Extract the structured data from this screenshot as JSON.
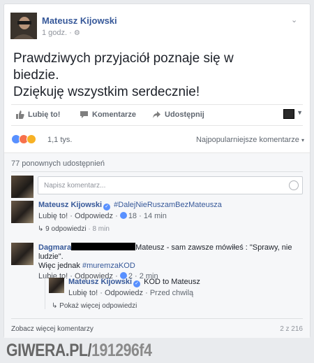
{
  "post": {
    "author": "Mateusz Kijowski",
    "time": "1 godz. ·",
    "text_line1": "Prawdziwych przyjaciół poznaje się w",
    "text_line2": "biedzie.",
    "text_line3": "Dziękuję wszystkim serdecznie!"
  },
  "actions": {
    "like": "Lubię to!",
    "comment": "Komentarze",
    "share": "Udostępnij"
  },
  "reactions": {
    "count": "1,1 tys.",
    "sort": "Najpopularniejsze komentarze"
  },
  "shares": "77 ponownych udostępnień",
  "composer": {
    "placeholder": "Napisz komentarz..."
  },
  "comments": [
    {
      "name": "Mateusz Kijowski",
      "text": "#DalejNieRuszamBezMateusza",
      "like": "Lubię to!",
      "reply": "Odpowiedz",
      "likes": "18",
      "time": "14 min",
      "replies": "9 odpowiedzi",
      "replies_time": "8 min"
    },
    {
      "name": "Dagmara",
      "text_after": "Mateusz - sam zawsze mówiłeś : \"Sprawy, nie ludzie\".",
      "text_line2_plain": "Więc jednak ",
      "text_line2_tag": "#muremzaKOD",
      "like": "Lubię to!",
      "reply": "Odpowiedz",
      "likes": "2",
      "time": "2 min"
    },
    {
      "name": "Mateusz Kijowski",
      "text": "KOD to Mateusz",
      "like": "Lubię to!",
      "reply": "Odpowiedz",
      "time": "Przed chwilą",
      "more_replies": "Pokaż więcej odpowiedzi"
    }
  ],
  "footer": {
    "more_comments": "Zobacz więcej komentarzy",
    "count": "2 z 216"
  },
  "watermark": {
    "site": "GIWERA.PL/",
    "id": "191296f4"
  },
  "colors": {
    "link": "#365899",
    "like_blue": "#5890ff",
    "angry": "#f7714c",
    "haha": "#f7b125"
  }
}
